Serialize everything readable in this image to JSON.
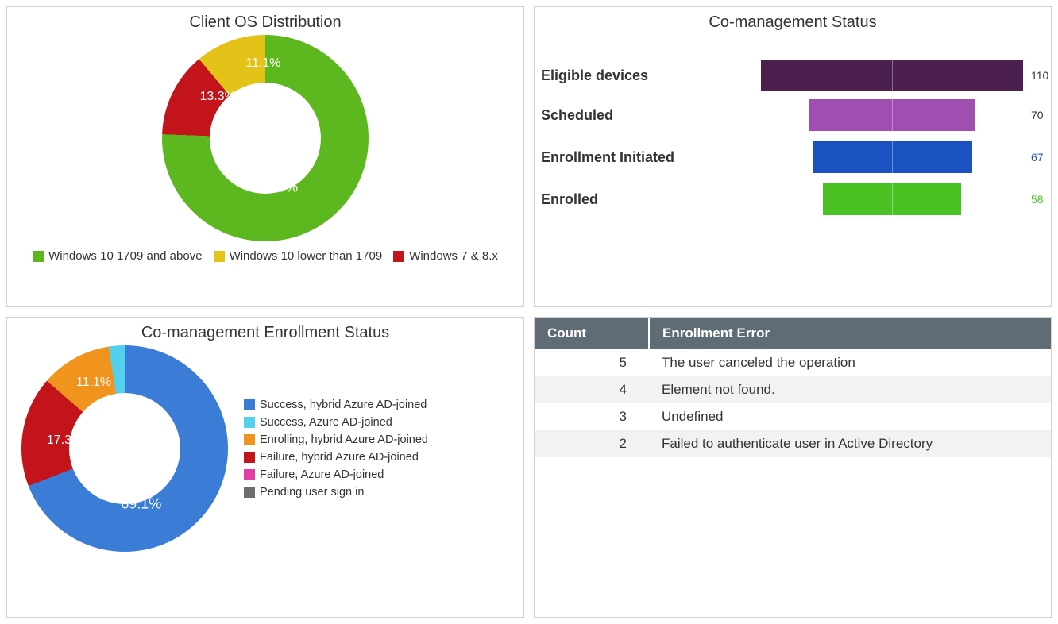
{
  "tiles": {
    "client_os": {
      "title": "Client OS Distribution",
      "legend": [
        {
          "label": "Windows 10 1709 and above",
          "color": "#5cb81e"
        },
        {
          "label": "Windows 10 lower than 1709",
          "color": "#e3c317"
        },
        {
          "label": "Windows 7 & 8.x",
          "color": "#c4141b"
        }
      ],
      "slice_labels": {
        "a": "75.6%",
        "b": "13.3%",
        "c": "11.1%"
      }
    },
    "comgmt_status": {
      "title": "Co-management Status",
      "rows": [
        {
          "label": "Eligible devices",
          "value": "110",
          "color": "#4b1f4e"
        },
        {
          "label": "Scheduled",
          "value": "70",
          "color": "#a04eb0"
        },
        {
          "label": "Enrollment Initiated",
          "value": "67",
          "color": "#1b52c1"
        },
        {
          "label": "Enrolled",
          "value": "58",
          "color": "#4bc224"
        }
      ],
      "value_colors": {
        "0": "#333",
        "1": "#333",
        "2": "#1b52c1",
        "3": "#4bc224"
      }
    },
    "enroll_status": {
      "title": "Co-management Enrollment Status",
      "legend": [
        {
          "label": "Success, hybrid Azure AD-joined",
          "color": "#3a7cd6"
        },
        {
          "label": "Success, Azure AD-joined",
          "color": "#53d0eb"
        },
        {
          "label": "Enrolling, hybrid Azure AD-joined",
          "color": "#f0941e"
        },
        {
          "label": "Failure, hybrid Azure AD-joined",
          "color": "#c4141b"
        },
        {
          "label": "Failure, Azure AD-joined",
          "color": "#e23ea6"
        },
        {
          "label": "Pending user sign in",
          "color": "#6d6d6d"
        }
      ],
      "slice_labels": {
        "a": "69.1%",
        "b": "17.3%",
        "c": "11.1%"
      }
    },
    "errors": {
      "headers": {
        "count": "Count",
        "err": "Enrollment Error"
      },
      "rows": [
        {
          "count": "5",
          "err": "The user canceled the operation"
        },
        {
          "count": "4",
          "err": "Element not found."
        },
        {
          "count": "3",
          "err": "Undefined"
        },
        {
          "count": "2",
          "err": "Failed to authenticate user in Active Directory"
        }
      ]
    }
  },
  "chart_data": [
    {
      "type": "pie",
      "title": "Client OS Distribution",
      "series": [
        {
          "name": "Windows 10 1709 and above",
          "value": 75.6,
          "color": "#5cb81e"
        },
        {
          "name": "Windows 7 & 8.x",
          "value": 13.3,
          "color": "#c4141b"
        },
        {
          "name": "Windows 10 lower than 1709",
          "value": 11.1,
          "color": "#e3c317"
        }
      ],
      "unit": "percent",
      "donut_hole": true
    },
    {
      "type": "bar",
      "title": "Co-management Status",
      "orientation": "funnel-horizontal",
      "categories": [
        "Eligible devices",
        "Scheduled",
        "Enrollment Initiated",
        "Enrolled"
      ],
      "values": [
        110,
        70,
        67,
        58
      ],
      "colors": [
        "#4b1f4e",
        "#a04eb0",
        "#1b52c1",
        "#4bc224"
      ],
      "xlim": [
        0,
        110
      ]
    },
    {
      "type": "pie",
      "title": "Co-management Enrollment Status",
      "series": [
        {
          "name": "Success, hybrid Azure AD-joined",
          "value": 69.1,
          "color": "#3a7cd6"
        },
        {
          "name": "Success, Azure AD-joined",
          "value": 2.5,
          "color": "#53d0eb"
        },
        {
          "name": "Enrolling, hybrid Azure AD-joined",
          "value": 11.1,
          "color": "#f0941e"
        },
        {
          "name": "Failure, hybrid Azure AD-joined",
          "value": 17.3,
          "color": "#c4141b"
        },
        {
          "name": "Failure, Azure AD-joined",
          "value": 0.0,
          "color": "#e23ea6"
        },
        {
          "name": "Pending user sign in",
          "value": 0.0,
          "color": "#6d6d6d"
        }
      ],
      "unit": "percent",
      "donut_hole": true,
      "labeled_slices": [
        "Success, hybrid Azure AD-joined",
        "Failure, hybrid Azure AD-joined",
        "Enrolling, hybrid Azure AD-joined"
      ]
    },
    {
      "type": "table",
      "title": "Enrollment Error",
      "columns": [
        "Count",
        "Enrollment Error"
      ],
      "rows": [
        [
          5,
          "The user canceled the operation"
        ],
        [
          4,
          "Element not found."
        ],
        [
          3,
          "Undefined"
        ],
        [
          2,
          "Failed to authenticate user in Active Directory"
        ]
      ]
    }
  ]
}
